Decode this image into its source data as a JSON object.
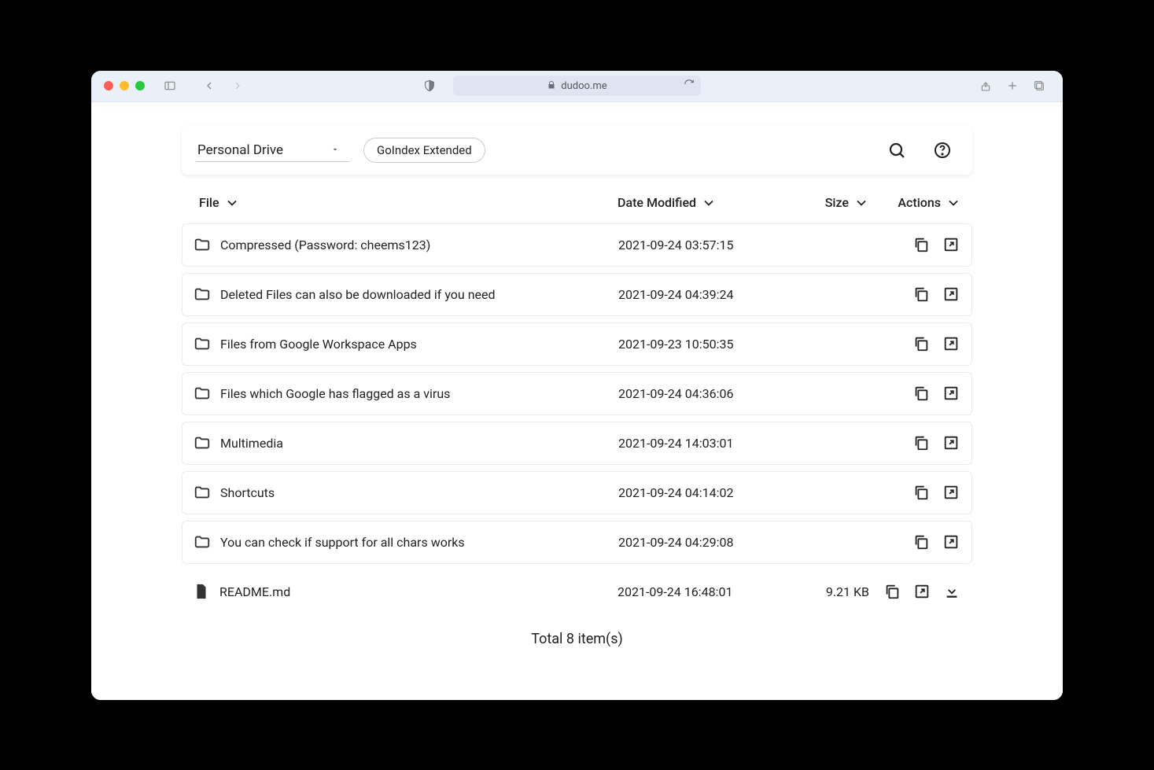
{
  "browser": {
    "url": "dudoo.me"
  },
  "topbar": {
    "drive_label": "Personal Drive",
    "chip_label": "GoIndex Extended"
  },
  "columns": {
    "file": "File",
    "date": "Date Modified",
    "size": "Size",
    "actions": "Actions"
  },
  "rows": [
    {
      "type": "folder",
      "name": "Compressed (Password: cheems123)",
      "date": "2021-09-24 03:57:15",
      "size": ""
    },
    {
      "type": "folder",
      "name": "Deleted Files can also be downloaded if you need",
      "date": "2021-09-24 04:39:24",
      "size": ""
    },
    {
      "type": "folder",
      "name": "Files from Google Workspace Apps",
      "date": "2021-09-23 10:50:35",
      "size": ""
    },
    {
      "type": "folder",
      "name": "Files which Google has flagged as a virus",
      "date": "2021-09-24 04:36:06",
      "size": ""
    },
    {
      "type": "folder",
      "name": "Multimedia",
      "date": "2021-09-24 14:03:01",
      "size": ""
    },
    {
      "type": "folder",
      "name": "Shortcuts",
      "date": "2021-09-24 04:14:02",
      "size": ""
    },
    {
      "type": "folder",
      "name": "You can check if support for all chars works",
      "date": "2021-09-24 04:29:08",
      "size": ""
    },
    {
      "type": "file",
      "name": "README.md",
      "date": "2021-09-24 16:48:01",
      "size": "9.21 KB"
    }
  ],
  "footer": "Total 8 item(s)"
}
